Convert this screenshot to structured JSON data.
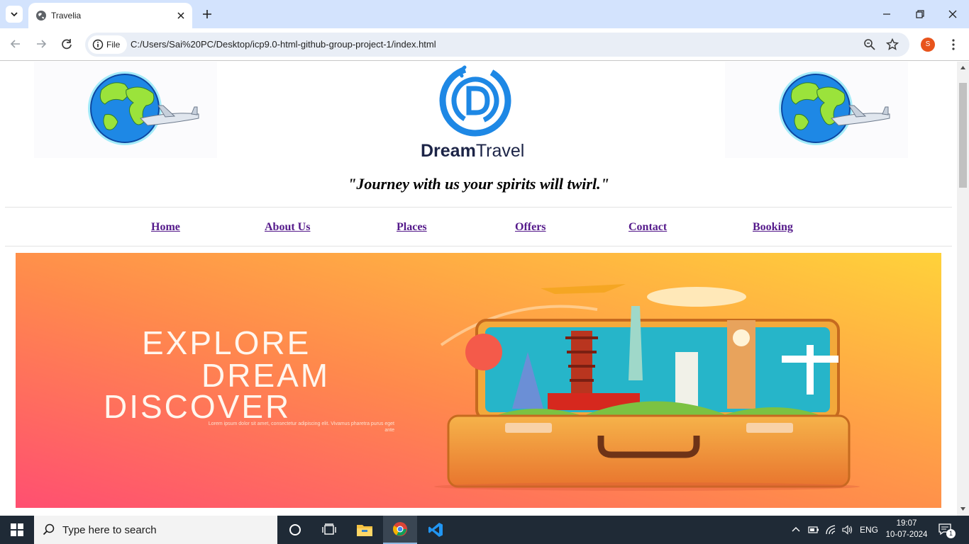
{
  "browser": {
    "tab_title": "Travelia",
    "address_chip": "File",
    "url": "C:/Users/Sai%20PC/Desktop/icp9.0-html-github-group-project-1/index.html",
    "profile_initial": "S"
  },
  "page": {
    "logo_bold": "Dream",
    "logo_light": "Travel",
    "tagline": "\"Journey with us your spirits will twirl.\"",
    "nav": [
      "Home",
      "About Us",
      "Places",
      "Offers",
      "Contact",
      "Booking"
    ],
    "banner": {
      "line1": "EXPLORE",
      "line2": "DREAM",
      "line3": "DISCOVER",
      "small_text": "Lorem ipsum dolor sit amet, consectetur adipiscing elit. Vivamus pharetra purus eget ante"
    }
  },
  "taskbar": {
    "search_placeholder": "Type here to search",
    "language": "ENG",
    "time": "19:07",
    "date": "10-07-2024",
    "notification_count": "1"
  },
  "colors": {
    "tabstrip": "#d3e3fd",
    "link_visited": "#551a8b",
    "banner_gradient_start": "#ff4f71",
    "banner_gradient_end": "#ffd23a",
    "taskbar": "#1f2a36"
  }
}
